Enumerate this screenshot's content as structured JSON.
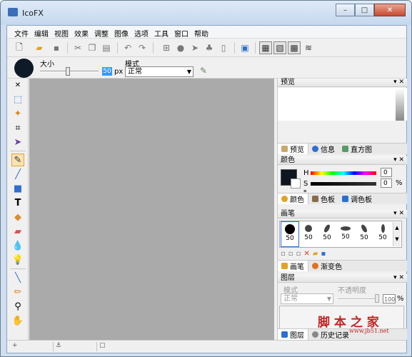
{
  "window": {
    "title": "IcoFX"
  },
  "menu": [
    "文件",
    "编辑",
    "视图",
    "效果",
    "调整",
    "图像",
    "选项",
    "工具",
    "窗口",
    "帮助"
  ],
  "options": {
    "size_label": "大小",
    "size_value": "50",
    "size_unit": "px",
    "mode_label": "模式",
    "mode_value": "正常"
  },
  "panels": {
    "preview": {
      "title": "预览",
      "tabs": [
        "预览",
        "信息",
        "直方图"
      ]
    },
    "color": {
      "title": "颜色",
      "h_label": "H",
      "s_label": "S",
      "b_label": "B",
      "h_value": "0",
      "s_value": "0",
      "s_unit": "%",
      "tabs": [
        "颜色",
        "色板",
        "调色板"
      ],
      "fg": "#0e1620"
    },
    "brush": {
      "title": "画笔",
      "sizes": [
        "50",
        "50",
        "50",
        "50",
        "50",
        "50"
      ],
      "tabs": [
        "画笔",
        "渐变色"
      ]
    },
    "layers": {
      "title": "图层",
      "mode_label": "模式",
      "opacity_label": "不透明度",
      "mode_value": "正常",
      "opacity_value": "100",
      "opacity_unit": "%",
      "tabs": [
        "图层",
        "历史记录"
      ]
    }
  },
  "watermark": {
    "text": "脚 本 之 家",
    "url": "www.jb51.net"
  },
  "icons": {
    "window": "app-icon",
    "tools": [
      "select-rect-icon",
      "magic-wand-icon",
      "crop-icon",
      "move-icon",
      "brush-icon",
      "line-icon",
      "rect-icon",
      "text-icon",
      "fill-icon",
      "eraser-icon",
      "drop-icon",
      "bulb-icon",
      "eyedropper-icon",
      "pencil-icon",
      "zoom-icon",
      "hand-icon"
    ]
  }
}
